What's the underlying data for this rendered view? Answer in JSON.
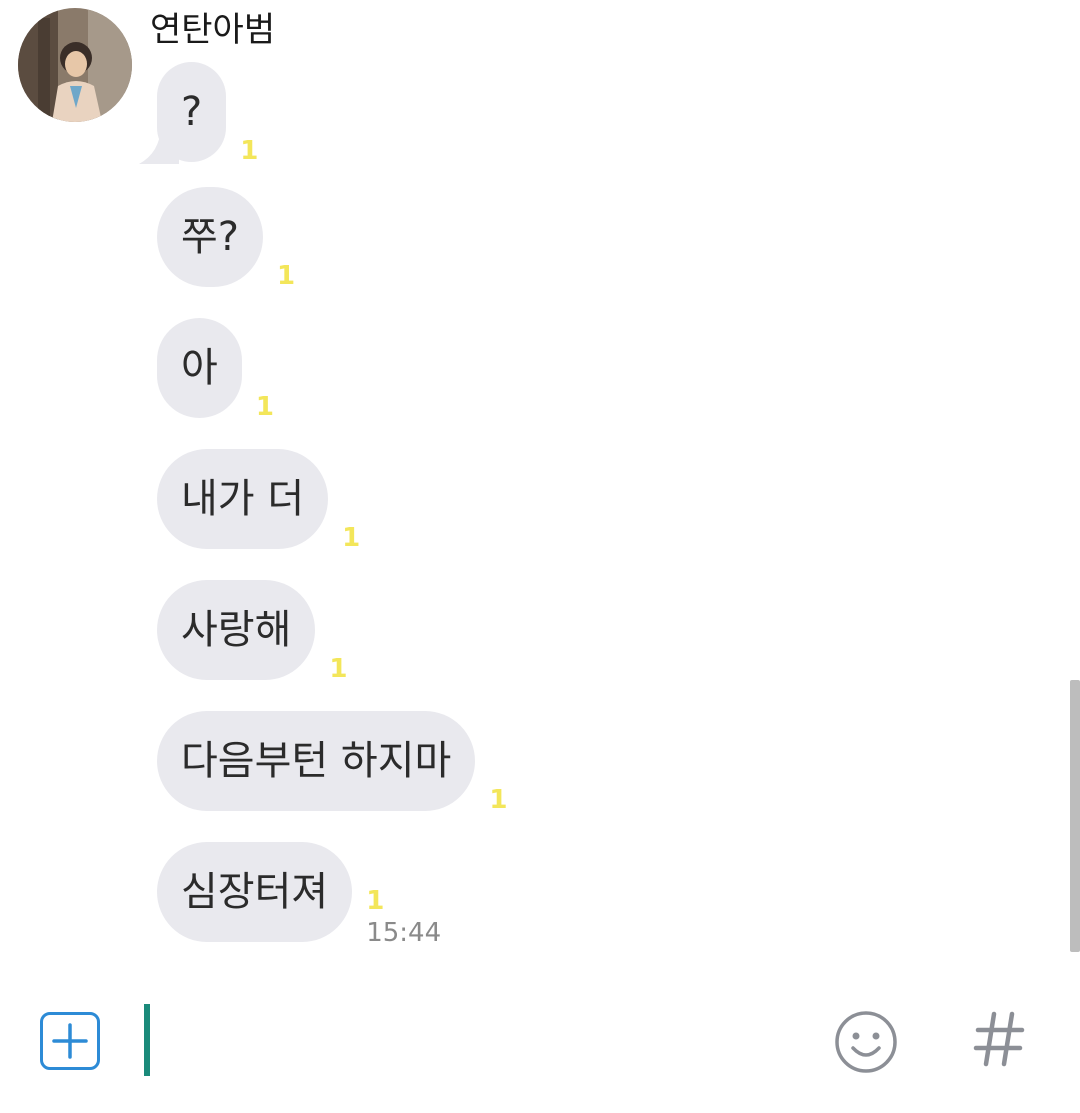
{
  "chat": {
    "sender_name": "연탄아범"
  },
  "messages": [
    {
      "text": "?",
      "unread": "1",
      "time": ""
    },
    {
      "text": "쭈?",
      "unread": "1",
      "time": ""
    },
    {
      "text": "아",
      "unread": "1",
      "time": ""
    },
    {
      "text": "내가 더",
      "unread": "1",
      "time": ""
    },
    {
      "text": "사랑해",
      "unread": "1",
      "time": ""
    },
    {
      "text": "다음부턴 하지마",
      "unread": "1",
      "time": ""
    },
    {
      "text": "심장터져",
      "unread": "1",
      "time": "15:44"
    }
  ],
  "input_bar": {
    "attach_icon": "plus-square-icon",
    "emoji_icon": "smiley-icon",
    "hashtag_icon": "hashtag-icon",
    "accent_color": "#2d8bd6",
    "caret_color": "#1a8a7a"
  },
  "colors": {
    "bubble": "#e9e9ee",
    "unread_badge": "#f3e65a"
  }
}
